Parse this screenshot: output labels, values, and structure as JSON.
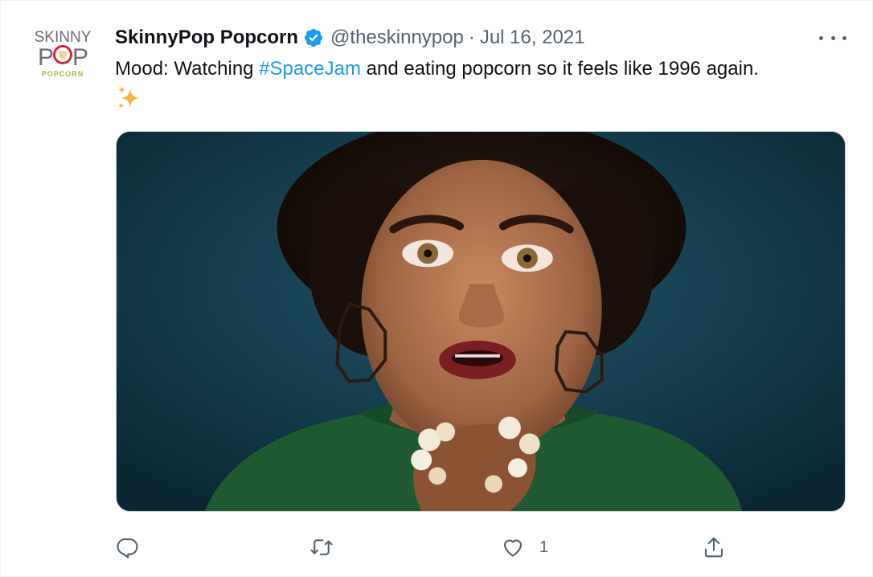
{
  "author": {
    "avatar_logo": {
      "line1": "SKINNY",
      "line2_left": "P",
      "line2_right": "P",
      "line3": "POPCORN"
    },
    "name": "SkinnyPop Popcorn",
    "handle": "@theskinnypop",
    "separator": "·",
    "date": "Jul 16, 2021",
    "verified_icon": "verified-badge-icon",
    "more_icon": "more-dots-icon"
  },
  "tweet": {
    "text_before": "Mood: Watching ",
    "hashtag": "#SpaceJam",
    "text_after": " and eating popcorn so it feels like 1996 again.",
    "emoji_icon": "sparkles-icon"
  },
  "media": {
    "image_icon": "photo-woman-eating-popcorn"
  },
  "actions": {
    "reply_icon": "reply-icon",
    "retweet_icon": "retweet-icon",
    "like_icon": "heart-icon",
    "like_count": "1",
    "share_icon": "share-icon"
  },
  "colors": {
    "hashtag": "#1d9bf0",
    "verified": "#1d9bf0",
    "secondary_text": "#536471",
    "brand_red": "#e0233a",
    "brand_green": "#a7b43a"
  }
}
